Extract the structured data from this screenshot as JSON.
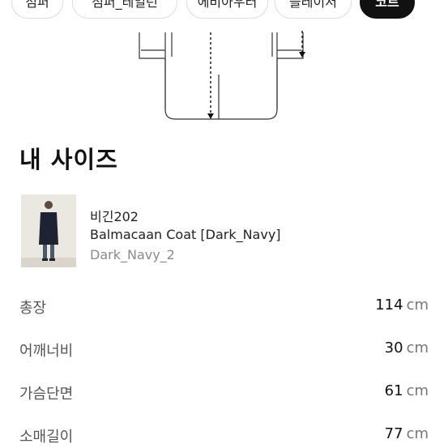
{
  "chips": [
    {
      "label": "점퍼",
      "active": false
    },
    {
      "label": "점퍼_테일런",
      "active": false
    },
    {
      "label": "에비아우터",
      "active": false
    },
    {
      "label": "블레이저",
      "active": false
    },
    {
      "label": "코트",
      "active": true
    }
  ],
  "section": {
    "title": "내 사이즈"
  },
  "product": {
    "brand": "비긴202",
    "name": "Balmacaan Coat [Dark_Navy]",
    "option": "Dark_Navy_2"
  },
  "measurements": [
    {
      "label": "총장",
      "value": "114",
      "unit": "cm"
    },
    {
      "label": "어깨너비",
      "value": "30",
      "unit": "cm"
    },
    {
      "label": "가슴단면",
      "value": "61",
      "unit": "cm"
    },
    {
      "label": "소매길이",
      "value": "77",
      "unit": "cm"
    }
  ],
  "colors": {
    "active_chip": "#111111",
    "label": "#555555",
    "unit": "#777777",
    "option": "#8a8a8a"
  }
}
